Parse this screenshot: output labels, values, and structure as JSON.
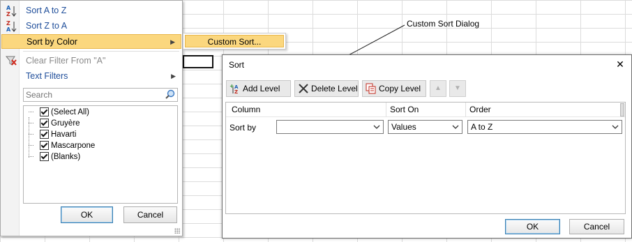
{
  "filter_menu": {
    "items": {
      "sort_a_z": "Sort A to Z",
      "sort_z_a": "Sort Z to A",
      "sort_by_color": "Sort by Color",
      "clear_filter": "Clear Filter From \"A\"",
      "text_filters": "Text Filters"
    },
    "search_placeholder": "Search",
    "checklist": [
      "(Select All)",
      "Gruyère",
      "Havarti",
      "Mascarpone",
      "(Blanks)"
    ],
    "ok_label": "OK",
    "cancel_label": "Cancel"
  },
  "submenu": {
    "custom_sort": "Custom Sort..."
  },
  "annotation": {
    "text": "Custom Sort Dialog"
  },
  "sort_dialog": {
    "title": "Sort",
    "toolbar": {
      "add_level": "Add Level",
      "delete_level": "Delete Level",
      "copy_level": "Copy Level"
    },
    "headers": {
      "column": "Column",
      "sort_on": "Sort On",
      "order": "Order"
    },
    "row": {
      "label": "Sort by",
      "column_value": "",
      "sort_on_value": "Values",
      "order_value": "A to Z"
    },
    "ok_label": "OK",
    "cancel_label": "Cancel"
  },
  "colors": {
    "highlight": "#fbd77e",
    "highlight_border": "#e8b64a",
    "menu_text": "#1f4e9a",
    "primary_border": "#3c7fb1"
  }
}
